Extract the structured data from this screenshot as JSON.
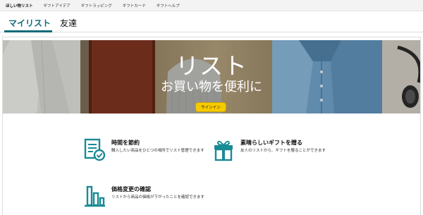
{
  "topnav": {
    "items": [
      "ほしい物リスト",
      "ギフトアイデア",
      "ギフトラッピング",
      "ギフトカード",
      "ギフトヘルプ"
    ]
  },
  "tabs": {
    "my_list": "マイリスト",
    "friends": "友達"
  },
  "hero": {
    "title": "リスト",
    "subtitle": "お買い物を便利に",
    "signin_label": "サインイン",
    "signin_color": "#f7ca00"
  },
  "features": [
    {
      "icon": "document-check-icon",
      "title": "時間を節約",
      "description": "購入したい商品をひとつの場所でリスト管理できます"
    },
    {
      "icon": "gift-icon",
      "title": "素晴らしいギフトを贈る",
      "description": "友人のリストから、ギフトを贈ることができます"
    },
    {
      "icon": "bar-chart-icon",
      "title": "価格変更の確認",
      "description": "リストから商品の価格が下がったことを確認できます"
    }
  ],
  "colors": {
    "accent": "#0f6b78",
    "icon": "#1a8a95"
  }
}
